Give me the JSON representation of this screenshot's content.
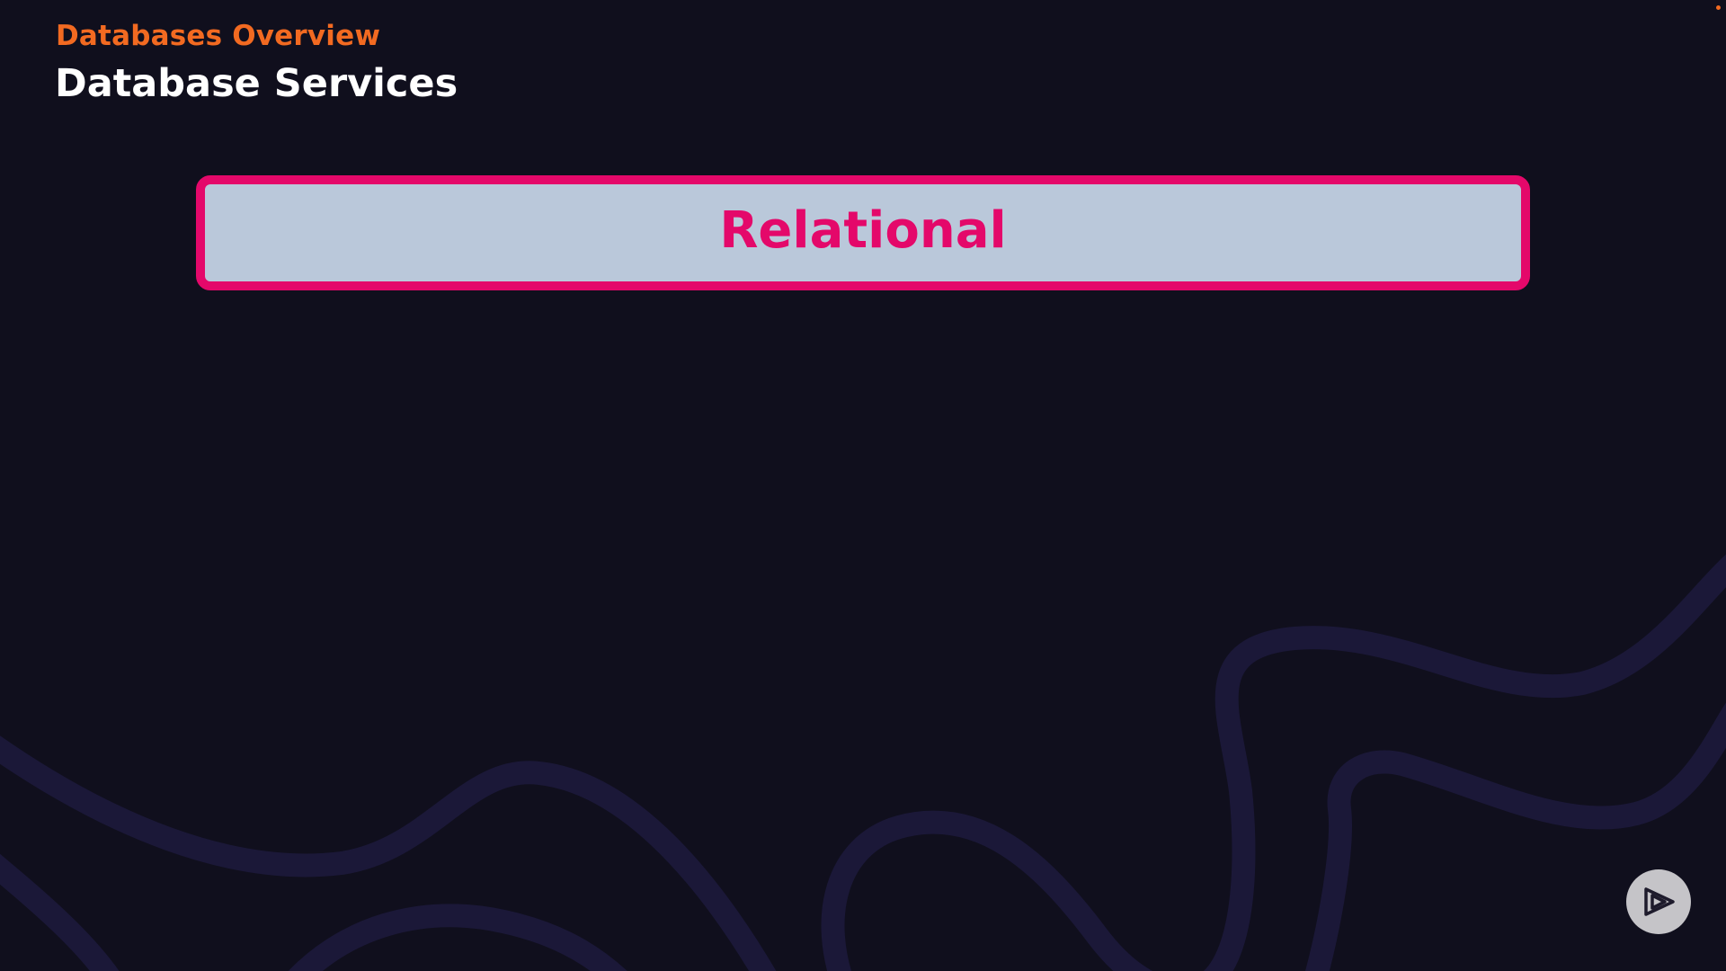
{
  "slide": {
    "section": "Databases Overview",
    "title": "Database Services"
  },
  "category": {
    "label": "Relational"
  },
  "colors": {
    "background": "#100f1d",
    "accent_orange": "#f26a21",
    "accent_pink": "#e4086a",
    "box_fill": "#bac8da",
    "wave_lines": "#1b1838"
  },
  "icons": {
    "brand_logo": "play-logo-icon"
  }
}
